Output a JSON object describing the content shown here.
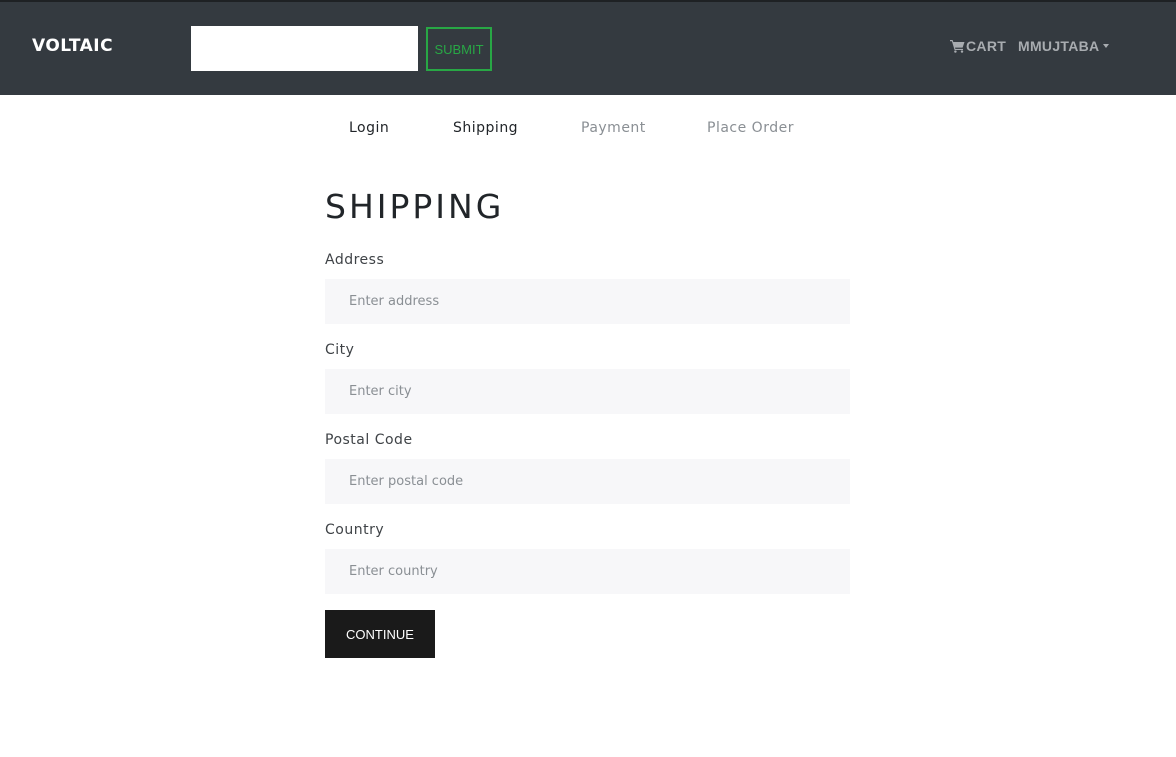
{
  "navbar": {
    "brand": "VOLTAIC",
    "search": {
      "value": "",
      "placeholder": ""
    },
    "submit_label": "SUBMIT",
    "cart_label": "CART",
    "user_label": "MMUJTABA",
    "colors": {
      "background": "#343a40",
      "submit_accent": "#28a745",
      "link": "#a8acb0"
    },
    "icons": {
      "cart": "cart-icon",
      "user_menu": "caret-down-icon"
    }
  },
  "checkout_steps": [
    {
      "label": "Login",
      "state": "enabled"
    },
    {
      "label": "Shipping",
      "state": "enabled"
    },
    {
      "label": "Payment",
      "state": "disabled"
    },
    {
      "label": "Place Order",
      "state": "disabled"
    }
  ],
  "form": {
    "title": "SHIPPING",
    "fields": [
      {
        "label": "Address",
        "placeholder": "Enter address",
        "value": ""
      },
      {
        "label": "City",
        "placeholder": "Enter city",
        "value": ""
      },
      {
        "label": "Postal Code",
        "placeholder": "Enter postal code",
        "value": ""
      },
      {
        "label": "Country",
        "placeholder": "Enter country",
        "value": ""
      }
    ],
    "submit_label": "CONTINUE"
  }
}
